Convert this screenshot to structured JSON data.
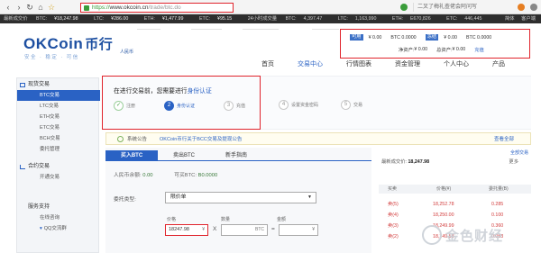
{
  "browser": {
    "url_scheme": "https://",
    "url_host": "www.okcoin.cn",
    "url_path": "/trade/btc.do",
    "search_hint": "二叉了梅礼查佬会阿问写"
  },
  "ticker": {
    "label": "最新成交价",
    "items": [
      {
        "name": "BTC:",
        "value": "¥18,247.98"
      },
      {
        "name": "LTC:",
        "value": "¥286.00"
      },
      {
        "name": "ETH:",
        "value": "¥1,477.99"
      },
      {
        "name": "ETC:",
        "value": "¥95.15"
      }
    ],
    "volume_label": "24小时成交量",
    "volumes": [
      {
        "name": "BTC:",
        "value": "4,397.47"
      },
      {
        "name": "LTC:",
        "value": "1,163,990"
      },
      {
        "name": "ETH:",
        "value": "E670,826"
      },
      {
        "name": "ETC:",
        "value": "446,445"
      }
    ],
    "right": [
      "简体",
      "客户端"
    ]
  },
  "header": {
    "logo_text": "OKCoin",
    "logo_zh": "币行",
    "logo_sub": "安全 · 稳定 · 可信",
    "logo_tag": "人民币"
  },
  "account": {
    "available_tag": "可用",
    "available_cny": "¥ 0.00",
    "available_btc": "BTC 0.0000",
    "frozen_tag": "冻结",
    "frozen_cny": "¥ 0.00",
    "frozen_btc": "BTC 0.0000",
    "net_label": "净资产:",
    "net_value": "¥ 0.00",
    "total_label": "总资产:",
    "total_value": "¥ 0.00",
    "recharge": "充值"
  },
  "nav": [
    "首页",
    "交易中心",
    "行情图表",
    "资金管理",
    "个人中心",
    "产品"
  ],
  "sidebar": {
    "spot_title": "现货交易",
    "spot_items": [
      "BTC交易",
      "LTC交易",
      "ETH交易",
      "ETC交易",
      "BCH交易",
      "委托管理"
    ],
    "contract_title": "合约交易",
    "contract_items": [
      "开通交易"
    ],
    "service_title": "服务支持",
    "service_items": [
      "在线咨询",
      "QQ交流群"
    ]
  },
  "verify": {
    "title_prefix": "在进行交易前，您需要进行",
    "title_link": "身份认证",
    "steps": [
      {
        "num": "✓",
        "label": "注册"
      },
      {
        "num": "2",
        "label": "身份认证"
      },
      {
        "num": "3",
        "label": "充值"
      },
      {
        "num": "4",
        "label": "设置资金密码"
      },
      {
        "num": "5",
        "label": "交易"
      }
    ]
  },
  "notice": {
    "label": "系统公告",
    "text": "OKCoin币行关于BCC交易及提现公告",
    "more": "查看全部"
  },
  "trade": {
    "tabs": [
      "买入BTC",
      "卖出BTC",
      "新手指南"
    ],
    "balance_label": "人民币余额:",
    "balance_value": "0.00",
    "buyable_label": "可买BTC:",
    "buyable_value": "B0.0000",
    "order_type_label": "委托类型:",
    "order_type_value": "限价单",
    "price_label": "价格",
    "amount_label": "数量",
    "total_label": "金额",
    "price_value": "18247.98",
    "price_unit": "¥",
    "amount_unit": "BTC",
    "total_unit": "¥"
  },
  "book": {
    "latest_label": "最新成交价:",
    "latest_value": "18,247.98",
    "more": "更多",
    "link": "全部交易",
    "headers": [
      "买卖",
      "价格(¥)",
      "委托量(B)"
    ],
    "rows": [
      {
        "label": "卖(5)",
        "price": "18,252.78",
        "amount": "0.285"
      },
      {
        "label": "卖(4)",
        "price": "18,250.00",
        "amount": "0.100"
      },
      {
        "label": "卖(3)",
        "price": "18,249.99",
        "amount": "0.360"
      },
      {
        "label": "卖(2)",
        "price": "18,249.58",
        "amount": "0.053"
      }
    ]
  },
  "watermark": {
    "text": "金色财经"
  }
}
